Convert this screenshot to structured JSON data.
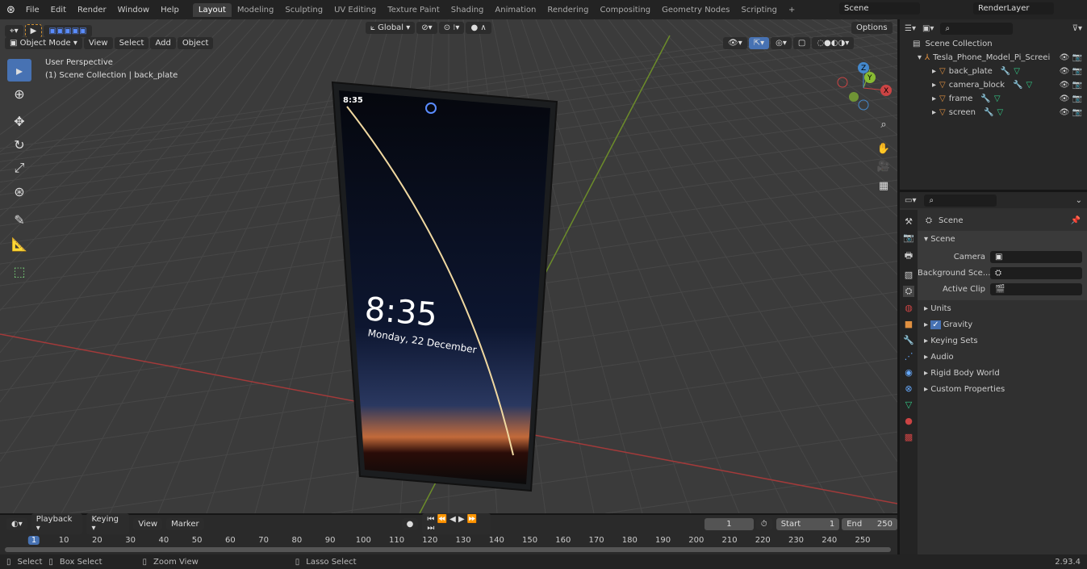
{
  "topbar": {
    "menus": [
      "File",
      "Edit",
      "Render",
      "Window",
      "Help"
    ],
    "workspaces": [
      "Layout",
      "Modeling",
      "Sculpting",
      "UV Editing",
      "Texture Paint",
      "Shading",
      "Animation",
      "Rendering",
      "Compositing",
      "Geometry Nodes",
      "Scripting"
    ],
    "active_workspace": "Layout",
    "scene": "Scene",
    "view_layer": "RenderLayer"
  },
  "viewport": {
    "mode": "Object Mode",
    "menus": [
      "View",
      "Select",
      "Add",
      "Object"
    ],
    "transform_orientation": "Global",
    "options": "Options",
    "overlay_title": "User Perspective",
    "overlay_subtitle": "(1) Scene Collection | back_plate",
    "phone": {
      "status_time": "8:35",
      "clock": "8:35",
      "date": "Monday, 22 December"
    },
    "gizmo_axes": [
      "X",
      "Y",
      "Z"
    ],
    "colors": {
      "x_axis": "#a33a3a",
      "y_axis": "#6c8c2a",
      "bg": "#3b3b3b"
    }
  },
  "outliner": {
    "root": "Scene Collection",
    "collection": "Tesla_Phone_Model_Pi_Screei",
    "objects": [
      "back_plate",
      "camera_block",
      "frame",
      "screen"
    ]
  },
  "properties": {
    "context": "Scene",
    "panel": "Scene",
    "fields": [
      {
        "label": "Camera"
      },
      {
        "label": "Background Sce..."
      },
      {
        "label": "Active Clip"
      }
    ],
    "sections": [
      "Units",
      "Gravity",
      "Keying Sets",
      "Audio",
      "Rigid Body World",
      "Custom Properties"
    ],
    "gravity_checked": true
  },
  "timeline": {
    "menus": [
      "Playback",
      "Keying",
      "View",
      "Marker"
    ],
    "current_frame": "1",
    "start_label": "Start",
    "start": "1",
    "end_label": "End",
    "end": "250",
    "ticks": [
      "1",
      "10",
      "20",
      "30",
      "40",
      "50",
      "60",
      "70",
      "80",
      "90",
      "100",
      "110",
      "120",
      "130",
      "140",
      "150",
      "160",
      "170",
      "180",
      "190",
      "200",
      "210",
      "220",
      "230",
      "240",
      "250"
    ]
  },
  "statusbar": {
    "items": [
      "Select",
      "Box Select",
      "Zoom View",
      "Lasso Select"
    ],
    "version": "2.93.4"
  }
}
